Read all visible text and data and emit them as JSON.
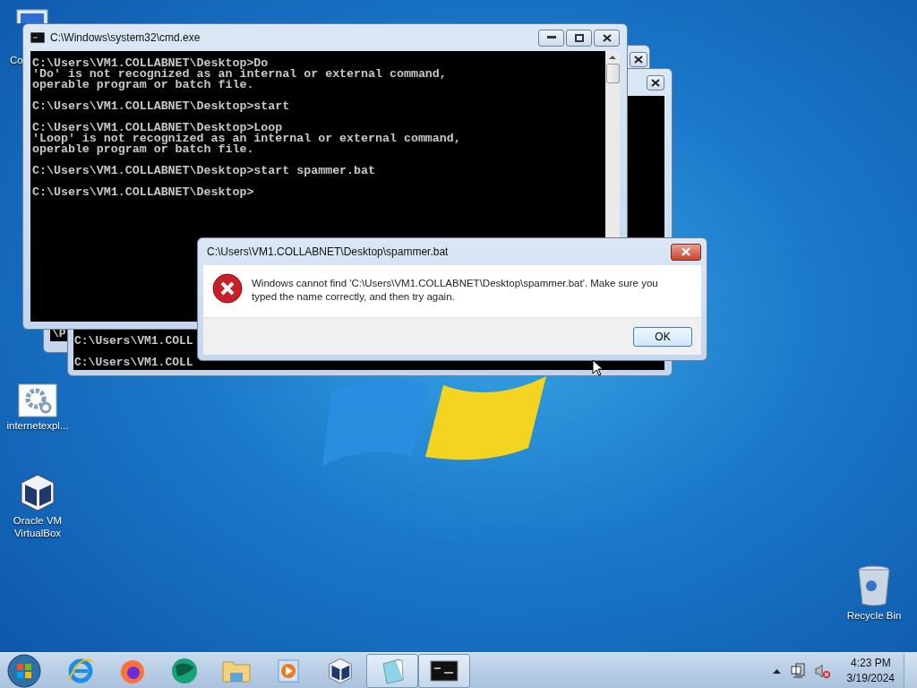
{
  "desktop_icons": [
    {
      "kind": "computer",
      "label": "Co"
    },
    {
      "kind": "settings",
      "label": "internetexpl..."
    },
    {
      "kind": "virtualbox",
      "label": "Oracle VM VirtualBox"
    },
    {
      "kind": "recycle",
      "label": "Recycle Bin"
    }
  ],
  "back_windows": [
    {
      "lines": [
        "\\P"
      ]
    },
    {
      "lines": [
        "C:\\Users\\VM1.COLL",
        "C:\\Users\\VM1.COLL"
      ]
    }
  ],
  "cmd_window": {
    "title": "C:\\Windows\\system32\\cmd.exe",
    "blocks": [
      [
        "C:\\Users\\VM1.COLLABNET\\Desktop>Do",
        "'Do' is not recognized as an internal or external command,",
        "operable program or batch file."
      ],
      [
        "C:\\Users\\VM1.COLLABNET\\Desktop>start"
      ],
      [
        "C:\\Users\\VM1.COLLABNET\\Desktop>Loop",
        "'Loop' is not recognized as an internal or external command,",
        "operable program or batch file."
      ],
      [
        "C:\\Users\\VM1.COLLABNET\\Desktop>start spammer.bat"
      ],
      [
        "C:\\Users\\VM1.COLLABNET\\Desktop>"
      ]
    ]
  },
  "dialog": {
    "title": "C:\\Users\\VM1.COLLABNET\\Desktop\\spammer.bat",
    "message": "Windows cannot find 'C:\\Users\\VM1.COLLABNET\\Desktop\\spammer.bat'. Make sure you typed the name correctly, and then try again.",
    "button": "OK"
  },
  "taskbar": {
    "apps": [
      {
        "kind": "ie",
        "active": false
      },
      {
        "kind": "firefox",
        "active": false
      },
      {
        "kind": "globe",
        "active": false
      },
      {
        "kind": "explorer",
        "active": false
      },
      {
        "kind": "media",
        "active": false
      },
      {
        "kind": "virtualbox",
        "active": false
      },
      {
        "kind": "notepad",
        "active": true
      },
      {
        "kind": "cmd",
        "active": true
      }
    ],
    "time": "4:23 PM",
    "date": "3/19/2024"
  }
}
